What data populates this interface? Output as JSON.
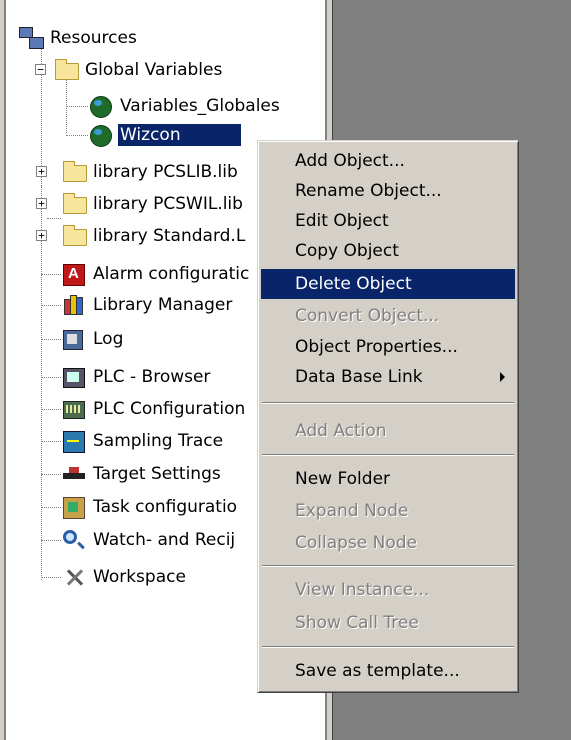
{
  "tree": {
    "items": [
      {
        "label": "Resources",
        "icon": "resources-icon"
      },
      {
        "label": "Global Variables",
        "icon": "folder-icon",
        "expander": "−"
      },
      {
        "label": "Variables_Globales",
        "icon": "globe-icon"
      },
      {
        "label": "Wizcon",
        "icon": "globe-icon"
      },
      {
        "label": "library PCSLIB.lib",
        "icon": "folder-icon",
        "expander": "+"
      },
      {
        "label": "library PCSWIL.lib",
        "icon": "folder-icon",
        "expander": "+"
      },
      {
        "label": "library Standard.L",
        "icon": "folder-icon",
        "expander": "+"
      },
      {
        "label": "Alarm configuratic",
        "icon": "alarm-icon"
      },
      {
        "label": "Library Manager",
        "icon": "library-manager-icon"
      },
      {
        "label": "Log",
        "icon": "log-icon"
      },
      {
        "label": "PLC - Browser",
        "icon": "plc-browser-icon"
      },
      {
        "label": "PLC Configuration",
        "icon": "plc-configuration-icon"
      },
      {
        "label": "Sampling Trace",
        "icon": "sampling-trace-icon"
      },
      {
        "label": "Target Settings",
        "icon": "target-settings-icon"
      },
      {
        "label": "Task configuratio",
        "icon": "task-configuration-icon"
      },
      {
        "label": "Watch- and Recij",
        "icon": "watch-icon"
      },
      {
        "label": "Workspace",
        "icon": "workspace-icon"
      }
    ]
  },
  "context_menu": {
    "items": [
      {
        "label": "Add Object...",
        "state": "enabled"
      },
      {
        "label": "Rename Object...",
        "state": "enabled"
      },
      {
        "label": "Edit Object",
        "state": "enabled"
      },
      {
        "label": "Copy Object",
        "state": "enabled"
      },
      {
        "label": "Delete Object",
        "state": "highlighted"
      },
      {
        "label": "Convert Object...",
        "state": "disabled"
      },
      {
        "label": "Object Properties...",
        "state": "enabled"
      },
      {
        "label": "Data Base Link",
        "state": "enabled",
        "submenu": true
      },
      {
        "label": "Add Action",
        "state": "disabled"
      },
      {
        "label": "New Folder",
        "state": "enabled"
      },
      {
        "label": "Expand Node",
        "state": "disabled"
      },
      {
        "label": "Collapse Node",
        "state": "disabled"
      },
      {
        "label": "View Instance...",
        "state": "disabled"
      },
      {
        "label": "Show Call Tree",
        "state": "disabled"
      },
      {
        "label": "Save as template...",
        "state": "enabled"
      }
    ]
  },
  "colors": {
    "selection": "#0a246a",
    "panel_background": "#ffffff",
    "menu_background": "#d4d0c8",
    "workspace_background": "#808080",
    "disabled_text": "#808080"
  }
}
